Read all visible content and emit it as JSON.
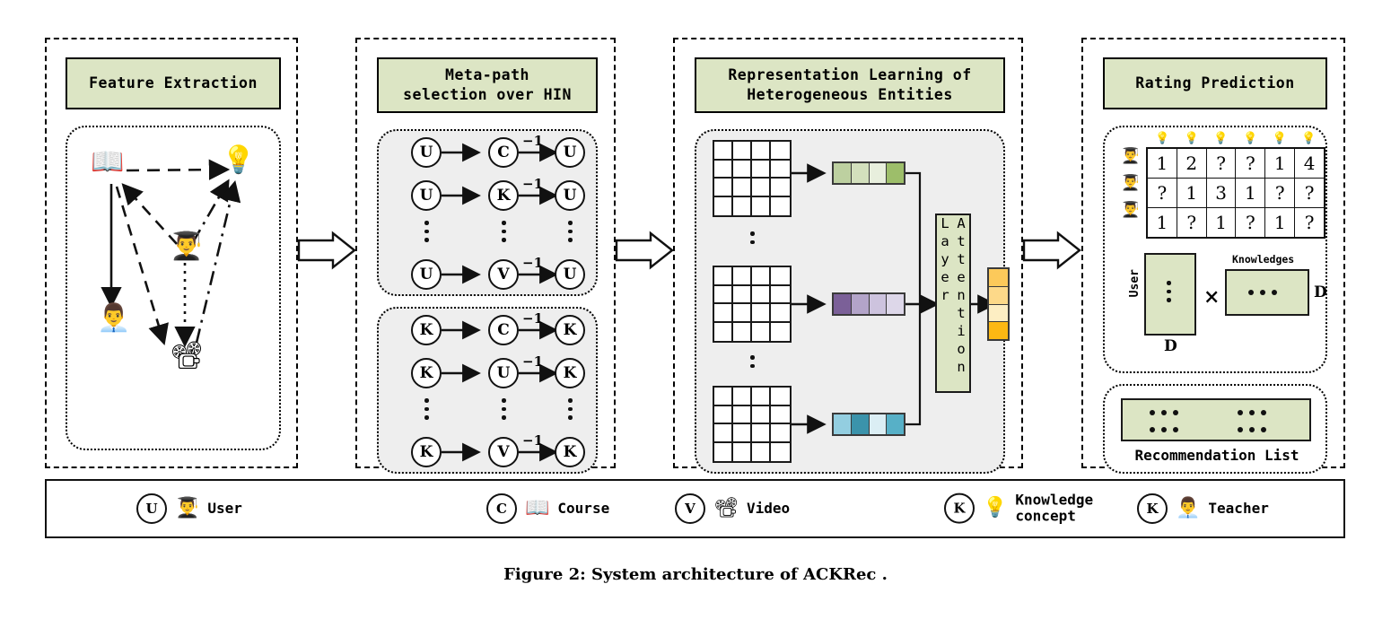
{
  "figure": {
    "caption": "Figure 2: System architecture of ACKRec ."
  },
  "panels": [
    {
      "id": "feature-extraction",
      "title": "Feature Extraction"
    },
    {
      "id": "meta-path-selection",
      "title": "Meta-path\nselection over HIN"
    },
    {
      "id": "representation-learning",
      "title": "Representation Learning of\nHeterogeneous Entities"
    },
    {
      "id": "rating-prediction",
      "title": "Rating Prediction"
    }
  ],
  "feature_graph": {
    "nodes": [
      {
        "name": "course",
        "icon": "open-book-icon",
        "glyph": "📖"
      },
      {
        "name": "knowledge-concept",
        "icon": "hand-lightbulb-icon",
        "glyph": "💡"
      },
      {
        "name": "user",
        "icon": "graduate-student-icon",
        "glyph": "👨‍🎓"
      },
      {
        "name": "teacher",
        "icon": "teacher-icon",
        "glyph": "👨‍💼"
      },
      {
        "name": "video",
        "icon": "video-player-icon",
        "glyph": "📽"
      }
    ]
  },
  "meta_paths": {
    "group_user": {
      "rows": [
        {
          "a": "U",
          "b": "C",
          "c": "U",
          "exp": "−1"
        },
        {
          "a": "U",
          "b": "K",
          "c": "U",
          "exp": "−1"
        },
        {
          "a": "U",
          "b": "V",
          "c": "U",
          "exp": "−1"
        }
      ]
    },
    "group_knowledge": {
      "rows": [
        {
          "a": "K",
          "b": "C",
          "c": "K",
          "exp": "−1"
        },
        {
          "a": "K",
          "b": "U",
          "c": "K",
          "exp": "−1"
        },
        {
          "a": "K",
          "b": "V",
          "c": "K",
          "exp": "−1"
        }
      ]
    }
  },
  "representation": {
    "matrix_rows": 4,
    "matrix_cols": 4,
    "attention_label": "Attention Layer",
    "vectors": [
      {
        "name": "green-embedding",
        "colors": [
          "#bdd0a0",
          "#d3e0bd",
          "#e8efdd",
          "#9dbe6a"
        ]
      },
      {
        "name": "purple-embedding",
        "colors": [
          "#7b6098",
          "#b3a4c9",
          "#cdc3de",
          "#ddd7e9"
        ]
      },
      {
        "name": "cyan-embedding",
        "colors": [
          "#93cee0",
          "#3b93ab",
          "#dbeef4",
          "#57b0c7"
        ]
      }
    ],
    "output_vector": {
      "name": "attention-output",
      "colors": [
        "#fcc95a",
        "#fdd989",
        "#fdeec3",
        "#fcb813"
      ]
    }
  },
  "rating_prediction": {
    "column_icon": "hand-lightbulb-icon",
    "column_glyph": "💡",
    "row_icon": "graduate-student-icon",
    "row_glyph": "👨‍🎓",
    "matrix": [
      [
        "1",
        "2",
        "?",
        "?",
        "1",
        "4"
      ],
      [
        "?",
        "1",
        "3",
        "1",
        "?",
        "?"
      ],
      [
        "1",
        "?",
        "1",
        "?",
        "1",
        "?"
      ]
    ],
    "factorization": {
      "user_label": "User",
      "user_dim_label": "D",
      "multiply_symbol": "×",
      "knowledge_label": "Knowledges",
      "knowledge_dim_label": "D"
    },
    "recommendation": {
      "label": "Recommendation List"
    }
  },
  "legend": {
    "items": [
      {
        "code": "U",
        "icon": "graduate-student-icon",
        "glyph": "👨‍🎓",
        "label": "User"
      },
      {
        "code": "C",
        "icon": "open-book-icon",
        "glyph": "📖",
        "label": "Course"
      },
      {
        "code": "V",
        "icon": "video-player-icon",
        "glyph": "📽",
        "label": "Video"
      },
      {
        "code": "K",
        "icon": "hand-lightbulb-icon",
        "glyph": "💡",
        "label": "Knowledge\nconcept"
      },
      {
        "code": "K",
        "icon": "teacher-icon",
        "glyph": "👨‍💼",
        "label": "Teacher"
      }
    ]
  },
  "colors": {
    "panel_title_fill": "#dce5c4",
    "inner_gray_fill": "#eeeeee",
    "stroke": "#111111"
  }
}
